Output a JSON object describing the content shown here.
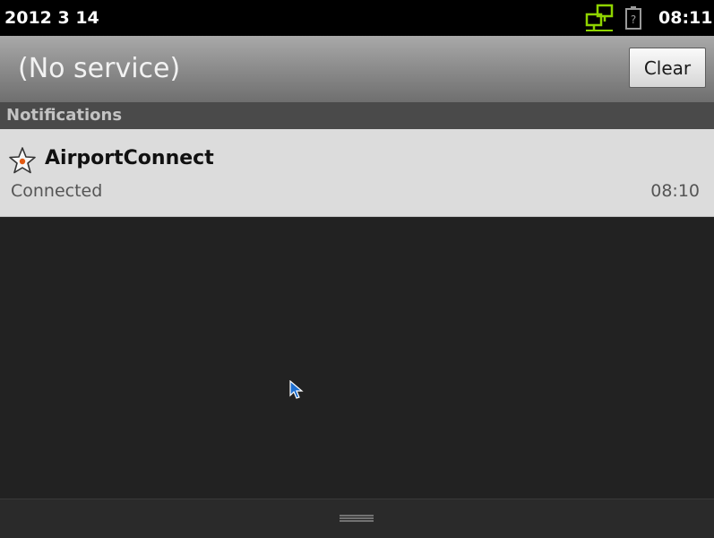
{
  "status_bar": {
    "date": "2012 3 14",
    "time": "08:11",
    "icons": [
      "network-activity-icon",
      "battery-unknown-icon"
    ],
    "network_icon_color": "#8fd400"
  },
  "carrier_bar": {
    "carrier_text": "(No service)",
    "clear_label": "Clear"
  },
  "notifications": {
    "header": "Notifications",
    "items": [
      {
        "icon": "star-icon",
        "title": "AirportConnect",
        "text": "Connected",
        "time": "08:10"
      }
    ]
  },
  "bottom_bar": {
    "handle_icon": "drag-handle-icon"
  },
  "colors": {
    "background": "#222222",
    "status_bar": "#000000",
    "notification_item": "#dcdcdc",
    "star_accent": "#e25a12"
  }
}
